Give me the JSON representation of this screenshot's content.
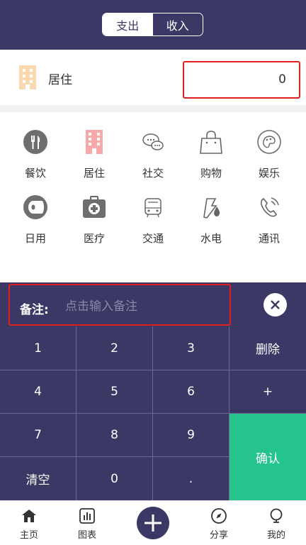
{
  "header": {
    "tabs": [
      {
        "label": "支出",
        "active": true
      },
      {
        "label": "收入",
        "active": false
      }
    ]
  },
  "selected": {
    "icon": "building-icon",
    "label": "居住",
    "amount": "0"
  },
  "categories": [
    {
      "label": "餐饮",
      "icon": "utensils-icon"
    },
    {
      "label": "居住",
      "icon": "building-icon"
    },
    {
      "label": "社交",
      "icon": "chat-bubbles-icon"
    },
    {
      "label": "购物",
      "icon": "shopping-bag-icon"
    },
    {
      "label": "娱乐",
      "icon": "palette-icon"
    },
    {
      "label": "日用",
      "icon": "tissue-roll-icon"
    },
    {
      "label": "医疗",
      "icon": "medical-kit-icon"
    },
    {
      "label": "交通",
      "icon": "bus-icon"
    },
    {
      "label": "水电",
      "icon": "water-electricity-icon"
    },
    {
      "label": "通讯",
      "icon": "phone-icon"
    }
  ],
  "note": {
    "label": "备注:",
    "placeholder": "点击输入备注"
  },
  "keypad": {
    "keys": [
      "1",
      "2",
      "3",
      "删除",
      "4",
      "5",
      "6",
      "+",
      "7",
      "8",
      "9",
      "清空",
      "0",
      "."
    ],
    "confirm": "确认"
  },
  "tabbar": {
    "items": [
      {
        "label": "主页",
        "icon": "home-icon"
      },
      {
        "label": "图表",
        "icon": "chart-icon"
      },
      {
        "label": "分享",
        "icon": "compass-icon"
      },
      {
        "label": "我的",
        "icon": "user-icon"
      }
    ],
    "add_icon": "plus-icon"
  },
  "colors": {
    "primary": "#3b3866",
    "confirm": "#25c48c",
    "highlight_border": "#e02020",
    "accent_pink": "#f7a8a8"
  }
}
